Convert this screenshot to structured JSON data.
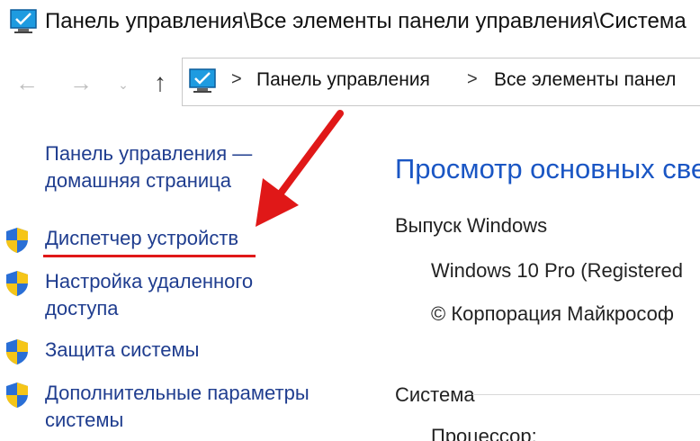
{
  "window": {
    "title": "Панель управления\\Все элементы панели управления\\Система"
  },
  "navigation": {
    "back_icon": "←",
    "forward_icon": "→",
    "recent_icon": "⌄",
    "up_icon": "↑",
    "separator": ">",
    "breadcrumbs": [
      "Панель управления",
      "Все элементы панел"
    ]
  },
  "sidebar": {
    "home_link": "Панель управления — домашняя страница",
    "items": [
      {
        "label": "Диспетчер устройств"
      },
      {
        "label": "Настройка удаленного доступа"
      },
      {
        "label": "Защита системы"
      },
      {
        "label": "Дополнительные параметры системы"
      }
    ]
  },
  "content": {
    "heading": "Просмотр основных све",
    "edition_section": "Выпуск Windows",
    "edition_value": "Windows 10 Pro (Registered",
    "copyright_value": "© Корпорация Майкрософ",
    "system_section": "Система",
    "processor_label": "Процессор:"
  },
  "colors": {
    "link": "#1f3d8f",
    "heading": "#1a56c4",
    "annotation": "#e01818"
  }
}
